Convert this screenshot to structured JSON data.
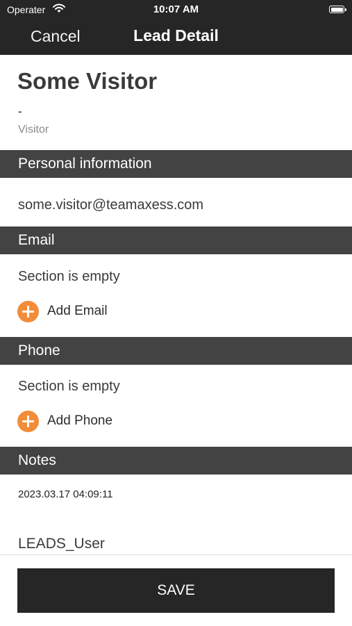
{
  "status_bar": {
    "carrier": "Operater",
    "time": "10:07 AM"
  },
  "nav": {
    "cancel_label": "Cancel",
    "title": "Lead Detail"
  },
  "lead": {
    "name": "Some Visitor",
    "subtitle": "-",
    "type": "Visitor"
  },
  "sections": {
    "personal": {
      "header": "Personal information",
      "email_value": "some.visitor@teamaxess.com"
    },
    "email": {
      "header": "Email",
      "empty_text": "Section is empty",
      "add_label": "Add Email"
    },
    "phone": {
      "header": "Phone",
      "empty_text": "Section is empty",
      "add_label": "Add Phone"
    },
    "notes": {
      "header": "Notes",
      "date": "2023.03.17 04:09:11",
      "user": "LEADS_User"
    }
  },
  "footer": {
    "save_label": "SAVE"
  },
  "colors": {
    "bar_dark": "#262626",
    "section_header": "#434343",
    "accent": "#f28c38"
  }
}
